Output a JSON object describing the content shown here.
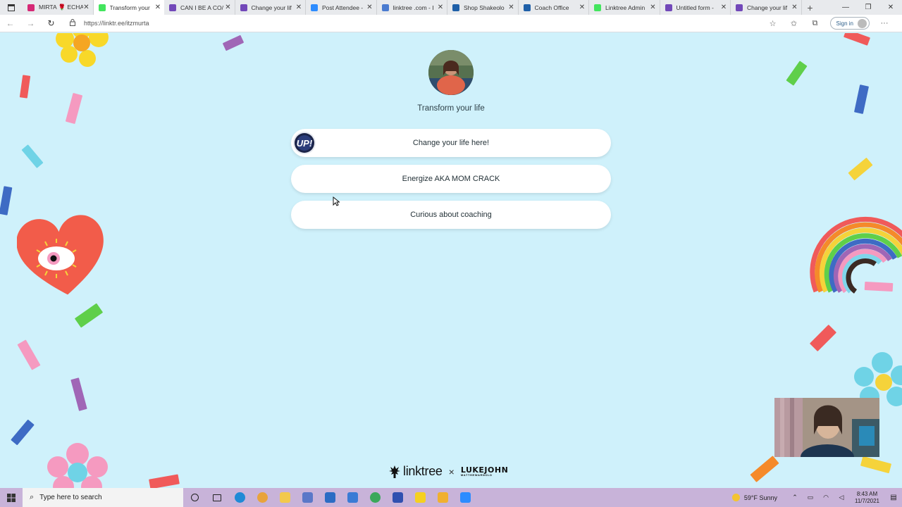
{
  "browser": {
    "tabs": [
      {
        "title": "MIRTA 🌹 ECHA",
        "favicon_color": "#d62976"
      },
      {
        "title": "Transform your",
        "favicon_color": "#43e55e",
        "active": true
      },
      {
        "title": "CAN I BE A CO/",
        "favicon_color": "#7248b9"
      },
      {
        "title": "Change your lif",
        "favicon_color": "#7248b9"
      },
      {
        "title": "Post Attendee -",
        "favicon_color": "#2d8cff"
      },
      {
        "title": "linktree .com - I",
        "favicon_color": "#4a7bd0"
      },
      {
        "title": "Shop Shakeolo",
        "favicon_color": "#1e5fa8"
      },
      {
        "title": "Coach Office",
        "favicon_color": "#1e5fa8"
      },
      {
        "title": "Linktree Admin",
        "favicon_color": "#43e55e"
      },
      {
        "title": "Untitled form -",
        "favicon_color": "#7248b9"
      },
      {
        "title": "Change your lif",
        "favicon_color": "#7248b9"
      }
    ],
    "url": "https://linktr.ee/itzmurta",
    "signin_label": "Sign in"
  },
  "profile": {
    "bio": "Transform your life"
  },
  "links": [
    {
      "label": "Change your life here!",
      "thumb_text": "UP!"
    },
    {
      "label": "Energize AKA MOM CRACK"
    },
    {
      "label": "Curious about coaching"
    }
  ],
  "footer": {
    "brand": "linktree",
    "separator": "×",
    "partner_line1": "LUKEJOHN",
    "partner_line2": "MATTHEWARNOLD"
  },
  "taskbar": {
    "search_placeholder": "Type here to search",
    "weather": "59°F  Sunny",
    "time": "8:43 AM",
    "date": "11/7/2021",
    "apps": [
      {
        "name": "cortana",
        "color": "#ffffff"
      },
      {
        "name": "task-view",
        "color": "#ffffff"
      },
      {
        "name": "edge",
        "color": "#1f8ad6"
      },
      {
        "name": "chrome",
        "color": "#e8a33c"
      },
      {
        "name": "file-explorer",
        "color": "#f2c94c"
      },
      {
        "name": "store",
        "color": "#5a78c8"
      },
      {
        "name": "mail",
        "color": "#2b6cc4"
      },
      {
        "name": "dropbox",
        "color": "#3a7bd5"
      },
      {
        "name": "maps",
        "color": "#3aa85a"
      },
      {
        "name": "app-blue",
        "color": "#3050b0"
      },
      {
        "name": "sticky-notes",
        "color": "#f5d020"
      },
      {
        "name": "paint",
        "color": "#f0b030"
      },
      {
        "name": "zoom",
        "color": "#2d8cff"
      }
    ]
  },
  "colors": {
    "page_bg": "#cff1fb",
    "taskbar_bg": "#c8b3d9",
    "button_bg": "#ffffff"
  }
}
